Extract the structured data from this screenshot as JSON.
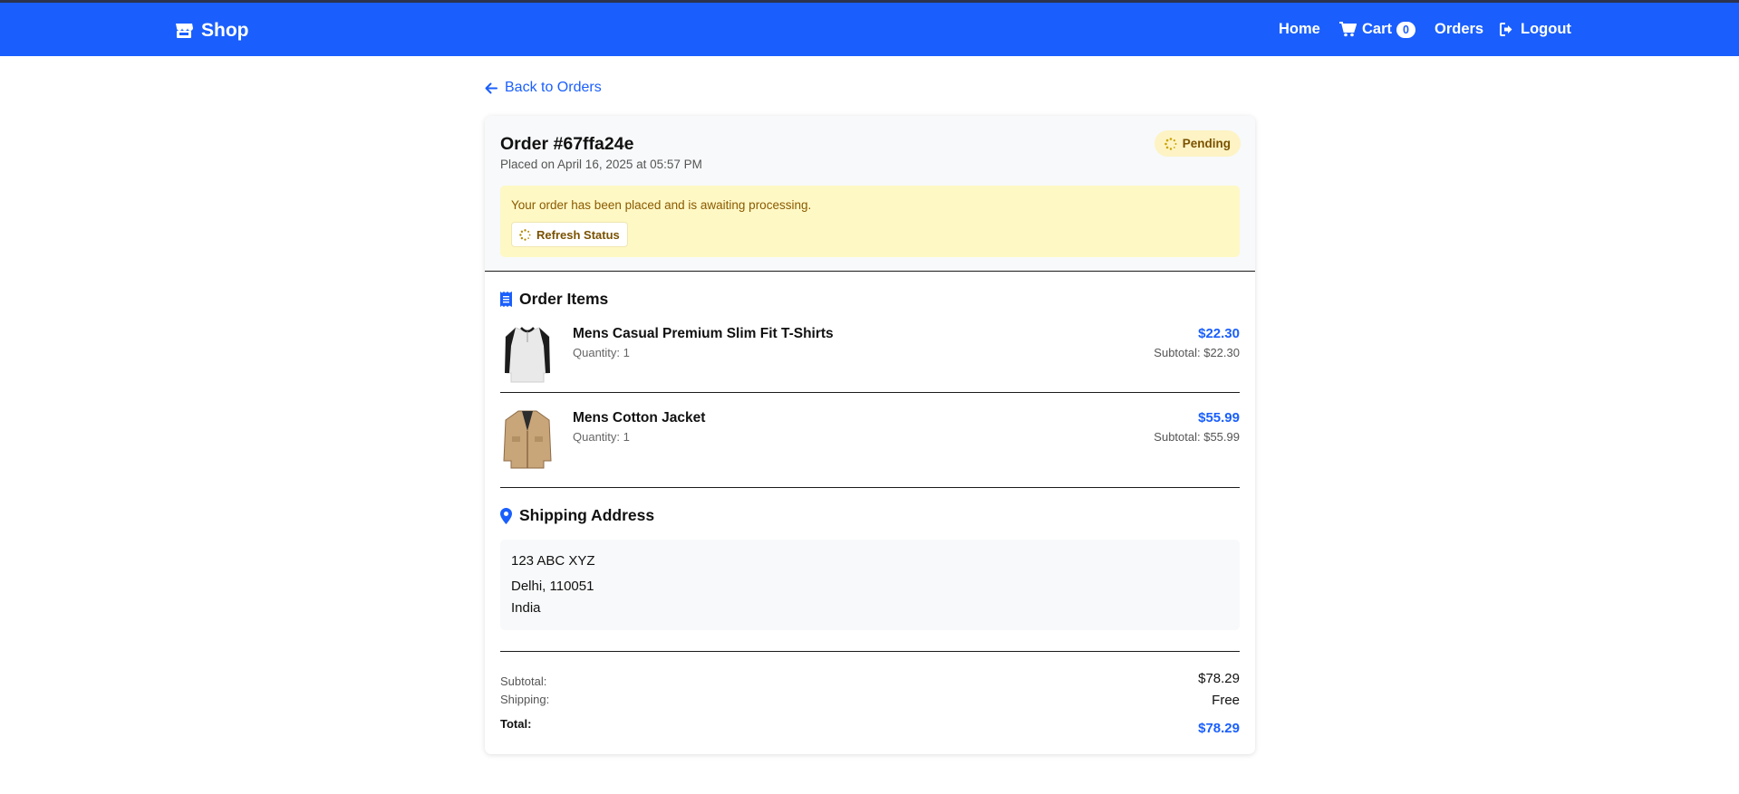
{
  "navbar": {
    "brand": "Shop",
    "links": {
      "home": "Home",
      "cart": "Cart",
      "cart_count": "0",
      "orders": "Orders",
      "logout": "Logout"
    },
    "bg_color": "#1a5ffd"
  },
  "back_link": "Back to Orders",
  "order": {
    "title": "Order #67ffa24e",
    "placed": "Placed on April 16, 2025 at 05:57 PM",
    "status": "Pending",
    "alert_text": "Your order has been placed and is awaiting processing.",
    "refresh_label": "Refresh Status"
  },
  "items_section": {
    "title": "Order Items",
    "items": [
      {
        "name": "Mens Casual Premium Slim Fit T-Shirts",
        "quantity": "Quantity: 1",
        "price": "$22.30",
        "subtotal": "Subtotal: $22.30"
      },
      {
        "name": "Mens Cotton Jacket",
        "quantity": "Quantity: 1",
        "price": "$55.99",
        "subtotal": "Subtotal: $55.99"
      }
    ]
  },
  "shipping": {
    "title": "Shipping Address",
    "line1": "123 ABC XYZ",
    "line2": "Delhi, 110051",
    "line3": "India"
  },
  "summary": {
    "subtotal_label": "Subtotal:",
    "subtotal_value": "$78.29",
    "shipping_label": "Shipping:",
    "shipping_value": "Free",
    "total_label": "Total:",
    "total_value": "$78.29"
  },
  "icons": [
    "store-icon",
    "cart-icon",
    "logout-icon",
    "arrow-left-icon",
    "spinner-icon",
    "receipt-icon",
    "map-pin-icon"
  ]
}
